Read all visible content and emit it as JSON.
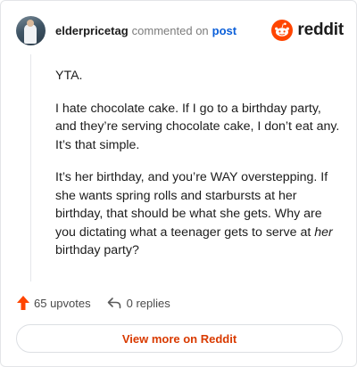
{
  "header": {
    "username": "elderpricetag",
    "action_text": "commented on",
    "post_link": "post",
    "brand_name": "reddit"
  },
  "comment": {
    "paragraph_1": "YTA.",
    "paragraph_2": "I hate chocolate cake. If I go to a birthday party, and they’re serving chocolate cake, I don’t eat any. It’s that simple.",
    "paragraph_3_before": "It’s her birthday, and you’re WAY overstepping. If she wants spring rolls and starbursts at her birthday, that should be what she gets. Why are you dictating what a teenager gets to serve at ",
    "paragraph_3_italic": "her",
    "paragraph_3_after": " birthday party?"
  },
  "footer": {
    "upvotes_label": "65 upvotes",
    "replies_label": "0 replies"
  },
  "actions": {
    "view_more_label": "View more on Reddit"
  },
  "colors": {
    "brand": "#ff4500",
    "link": "#0b5fd9",
    "cta": "#d93a00",
    "upvote": "#ff4500"
  },
  "icons": {
    "avatar": "user-avatar",
    "brand": "reddit-snoo-icon",
    "upvote": "upvote-arrow-icon",
    "reply": "reply-arrow-icon"
  }
}
